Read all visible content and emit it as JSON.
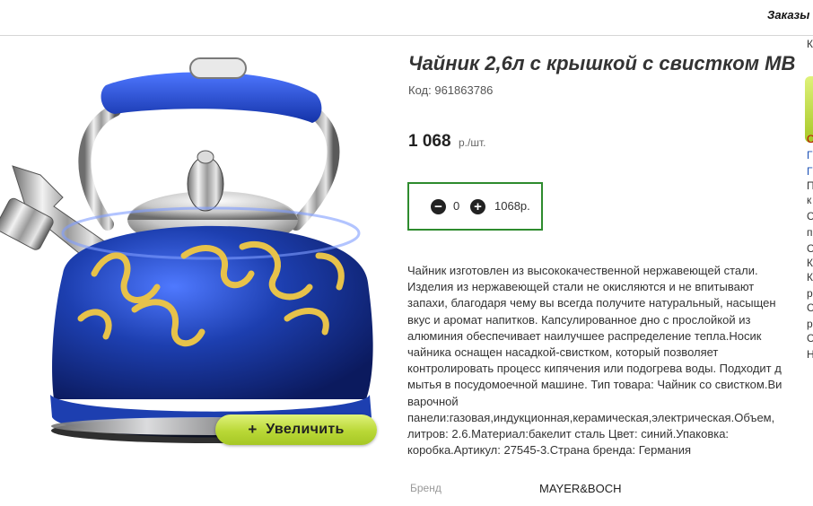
{
  "topbar": {
    "orders_link": "Заказы"
  },
  "product": {
    "title": "Чайник 2,6л с крышкой с свистком MB",
    "code_label": "Код:",
    "code_value": "961863786",
    "price": "1 068",
    "price_unit": "р./шт.",
    "zoom_label": "Увеличить",
    "zoom_plus": "+"
  },
  "cart": {
    "quantity": "0",
    "sum": "1068р."
  },
  "description": {
    "lines": [
      "Чайник изготовлен из высококачественной нержавеющей стали.",
      "Изделия из нержавеющей стали не окисляются и не впитывают",
      "запахи, благодаря чему вы всегда получите натуральный, насыщен",
      "вкус и аромат напитков. Капсулированное дно с прослойкой из",
      "алюминия обеспечивает наилучшее распределение тепла.Носик",
      "чайника оснащен насадкой-свистком, который позволяет",
      "контролировать процесс кипячения или подогрева воды. Подходит д",
      "мытья в посудомоечной машине. Тип товара: Чайник со свистком.Ви",
      "варочной",
      "панели:газовая,индукционная,керамическая,электрическая.Объем,",
      "литров: 2.6.Материал:бакелит сталь Цвет: синий.Упаковка:",
      "коробка.Артикул: 27545-3.Страна бренда: Германия"
    ]
  },
  "brand": {
    "label": "Бренд",
    "value": "MAYER&BOCH"
  },
  "right_strip": {
    "chars": [
      "К",
      "С",
      "Г",
      "Г",
      "П",
      "к",
      "С",
      "п",
      "С",
      "К",
      "К",
      "р",
      "С",
      "р",
      "С",
      "Н"
    ],
    "char_colors": [
      "#333333",
      "#c00000",
      "#1a4fb5",
      "#1a4fb5",
      "#333333",
      "#333333",
      "#333333",
      "#333333",
      "#333333",
      "#333333",
      "#333333",
      "#333333",
      "#333333",
      "#333333",
      "#333333",
      "#333333"
    ]
  },
  "colors": {
    "accent_green": "#2e8b2e",
    "button_lime": "#b9d836",
    "kettle_blue": "#1d3fb0",
    "ornament_gold": "#e7c24a"
  }
}
